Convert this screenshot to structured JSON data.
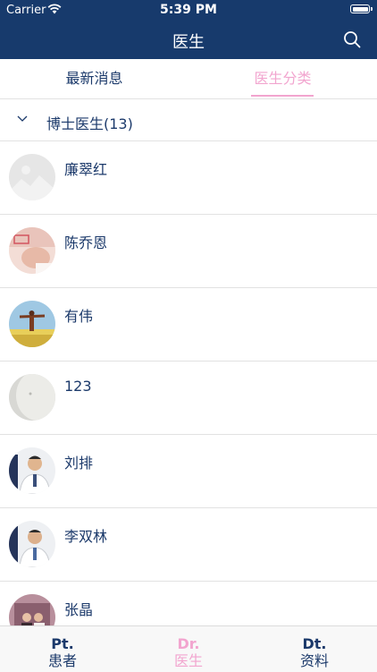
{
  "status_bar": {
    "carrier": "Carrier",
    "time": "5:39 PM"
  },
  "nav": {
    "title": "医生"
  },
  "tabs": [
    {
      "label": "最新消息",
      "active": false
    },
    {
      "label": "医生分类",
      "active": true
    }
  ],
  "group": {
    "label": "博士医生(13)"
  },
  "doctors": [
    {
      "name": "廉翠红"
    },
    {
      "name": "陈乔恩"
    },
    {
      "name": "有伟"
    },
    {
      "name": "123"
    },
    {
      "name": "刘排"
    },
    {
      "name": "李双林"
    },
    {
      "name": "张晶"
    }
  ],
  "tabbar": [
    {
      "en": "Pt.",
      "cn": "患者",
      "active": false
    },
    {
      "en": "Dr.",
      "cn": "医生",
      "active": true
    },
    {
      "en": "Dt.",
      "cn": "资料",
      "active": false
    }
  ],
  "colors": {
    "primary": "#173a6c",
    "accent": "#f2a5cf",
    "text": "#1c3a6b"
  },
  "icons": [
    "wifi-icon",
    "battery-icon",
    "search-icon",
    "chevron-down-icon"
  ]
}
